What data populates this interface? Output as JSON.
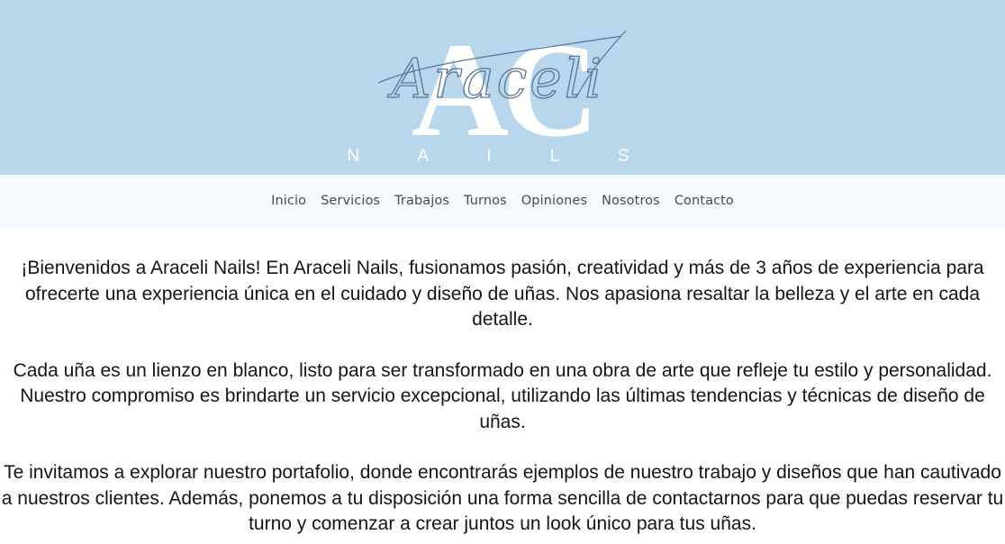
{
  "colors": {
    "header_bg": "#b8d7ec",
    "nav_bg": "#f7fafc",
    "logo_letters": "#ffffff",
    "logo_script": "#5b7594"
  },
  "logo": {
    "monogram": "AC",
    "script": "Araceli",
    "subtitle": "N A I L S"
  },
  "nav": {
    "items": [
      {
        "label": "Inicio"
      },
      {
        "label": "Servicios"
      },
      {
        "label": "Trabajos"
      },
      {
        "label": "Turnos"
      },
      {
        "label": "Opiniones"
      },
      {
        "label": "Nosotros"
      },
      {
        "label": "Contacto"
      }
    ]
  },
  "content": {
    "paragraphs": [
      "¡Bienvenidos a Araceli Nails! En Araceli Nails, fusionamos pasión, creatividad y más de 3 años de experiencia para ofrecerte una experiencia única en el cuidado y diseño de uñas. Nos apasiona resaltar la belleza y el arte en cada detalle.",
      "Cada uña es un lienzo en blanco, listo para ser transformado en una obra de arte que refleje tu estilo y personalidad. Nuestro compromiso es brindarte un servicio excepcional, utilizando las últimas tendencias y técnicas de diseño de uñas.",
      "Te invitamos a explorar nuestro portafolio, donde encontrarás ejemplos de nuestro trabajo y diseños que han cautivado a nuestros clientes. Además, ponemos a tu disposición una forma sencilla de contactarnos para que puedas reservar tu turno y comenzar a crear juntos un look único para tus uñas."
    ]
  }
}
